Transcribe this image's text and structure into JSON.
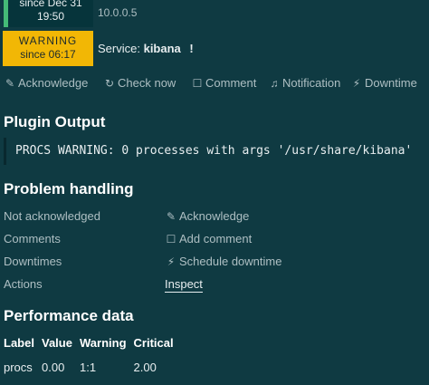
{
  "header": {
    "up_since": "since Dec 31",
    "up_time": "19:50",
    "host_ip": "10.0.0.5",
    "state_label": "WARNING",
    "state_since": "since 06:17",
    "service_prefix": "Service:",
    "service_name": "kibana",
    "service_flag": "!",
    "colors": {
      "ok": "#44bb77",
      "warning": "#f2b705",
      "background": "#0f3a42"
    }
  },
  "actions": [
    {
      "label": "Acknowledge",
      "icon": "edit-icon"
    },
    {
      "label": "Check now",
      "icon": "refresh-icon"
    },
    {
      "label": "Comment",
      "icon": "comment-icon"
    },
    {
      "label": "Notification",
      "icon": "bell-icon"
    },
    {
      "label": "Downtime",
      "icon": "plug-icon"
    }
  ],
  "plugin_output": {
    "title": "Plugin Output",
    "text": "PROCS WARNING: 0 processes with args '/usr/share/kibana'"
  },
  "problem_handling": {
    "title": "Problem handling",
    "rows": [
      {
        "label": "Not acknowledged",
        "action": "Acknowledge",
        "icon": "edit-icon"
      },
      {
        "label": "Comments",
        "action": "Add comment",
        "icon": "comment-icon"
      },
      {
        "label": "Downtimes",
        "action": "Schedule downtime",
        "icon": "plug-icon"
      },
      {
        "label": "Actions",
        "action": "Inspect",
        "icon": ""
      }
    ]
  },
  "performance": {
    "title": "Performance data",
    "columns": [
      "Label",
      "Value",
      "Warning",
      "Critical"
    ],
    "rows": [
      [
        "procs",
        "0.00",
        "1:1",
        "2.00"
      ]
    ]
  }
}
